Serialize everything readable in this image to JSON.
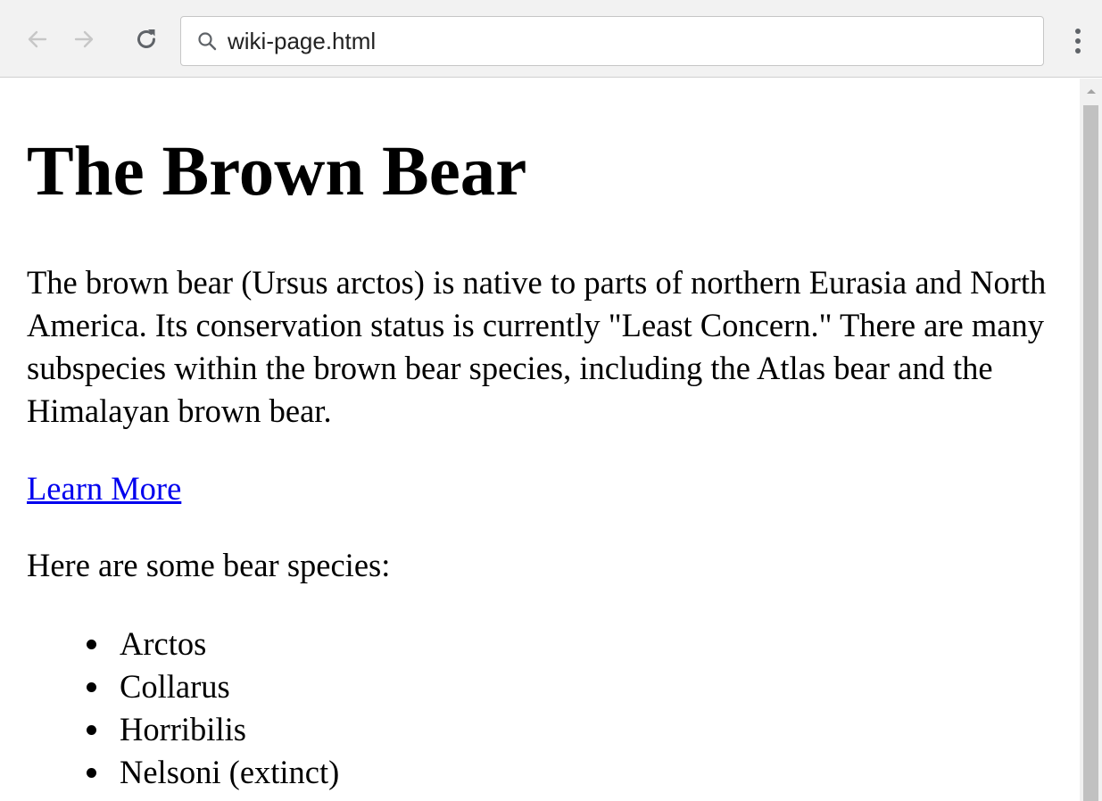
{
  "browser": {
    "address_text": "wiki-page.html",
    "icons": {
      "back": "arrow-left-icon",
      "forward": "arrow-right-icon",
      "reload": "reload-icon",
      "search": "search-icon",
      "menu": "more-vertical-icon"
    }
  },
  "page": {
    "title": "The Brown Bear",
    "intro": "The brown bear (Ursus arctos) is native to parts of northern Eurasia and North America. Its conservation status is currently \"Least Concern.\" There are many subspecies within the brown bear species, including the Atlas bear and the Himalayan brown bear.",
    "link_text": "Learn More",
    "species_intro": "Here are some bear species:",
    "species": [
      "Arctos",
      "Collarus",
      "Horribilis",
      "Nelsoni (extinct)"
    ]
  },
  "colors": {
    "link": "#0000ee",
    "toolbar": "#f2f2f2",
    "scrollbar_thumb": "#c1c1c1"
  }
}
